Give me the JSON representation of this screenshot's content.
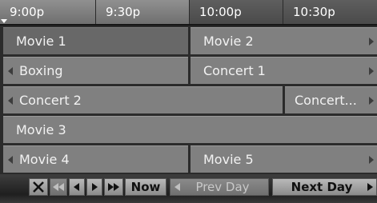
{
  "time_header": {
    "slots": [
      {
        "label": "9:00p"
      },
      {
        "label": "9:30p"
      },
      {
        "label": "10:00p"
      },
      {
        "label": "10:30p"
      }
    ]
  },
  "grid": {
    "rows": [
      [
        {
          "title": "Movie 1",
          "selected": true
        },
        {
          "title": "Movie 2",
          "continues_right": true
        }
      ],
      [
        {
          "title": "Boxing",
          "continues_left": true
        },
        {
          "title": "Concert 1",
          "continues_right": true
        }
      ],
      [
        {
          "title": "Concert 2",
          "continues_left": true
        },
        {
          "title": "Concert...",
          "continues_right": true
        }
      ],
      [
        {
          "title": "Movie 3"
        }
      ],
      [
        {
          "title": "Movie 4",
          "continues_left": true
        },
        {
          "title": "Movie 5",
          "continues_right": true
        }
      ]
    ]
  },
  "controls": {
    "close_icon": "close-x-icon",
    "first_icon": "double-left-arrow-icon",
    "prev_icon": "left-arrow-icon",
    "next_icon": "right-arrow-icon",
    "last_icon": "double-right-arrow-icon",
    "now_label": "Now",
    "prev_day_label": "Prev Day",
    "next_day_label": "Next Day",
    "prev_day_enabled": false
  },
  "colors": {
    "cell": "#808080",
    "cell_selected": "#686868",
    "header_slot": "#8a8a8a",
    "header_slot_dark": "#555555"
  }
}
